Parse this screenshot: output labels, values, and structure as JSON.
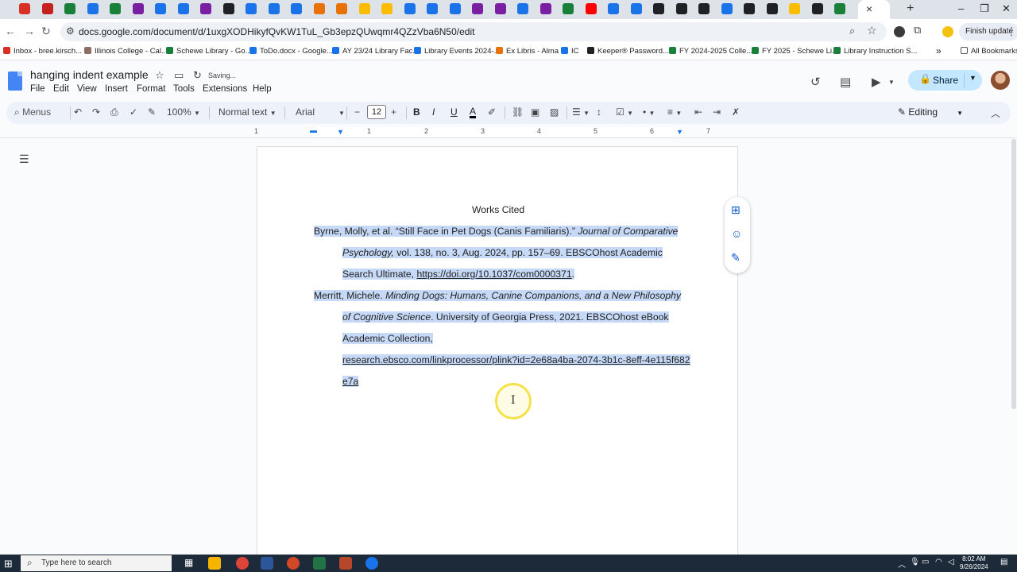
{
  "browser": {
    "url": "docs.google.com/document/d/1uxgXODHikyfQvKW1TuL_Gb3epzQUwqmr4QZzVba6N50/edit",
    "finish_update_label": "Finish update",
    "tab_close_glyph": "×",
    "new_tab_glyph": "+",
    "window_controls": {
      "minimize": "–",
      "restore": "❐",
      "close": "✕"
    },
    "tab_colors": [
      "#d93025",
      "#c5221f",
      "#188038",
      "#1a73e8",
      "#188038",
      "#7b1fa2",
      "#1a73e8",
      "#1a73e8",
      "#7b1fa2",
      "#202124",
      "#1a73e8",
      "#1a73e8",
      "#1a73e8",
      "#e8710a",
      "#e8710a",
      "#fbbc04",
      "#fbbc04",
      "#1a73e8",
      "#1a73e8",
      "#1a73e8",
      "#7b1fa2",
      "#7b1fa2",
      "#1a73e8",
      "#7b1fa2",
      "#188038",
      "#ff0000",
      "#1a73e8",
      "#1a73e8",
      "#202124",
      "#202124",
      "#202124",
      "#1a73e8",
      "#202124",
      "#202124",
      "#fbbc04",
      "#202124",
      "#188038",
      "#1a73e8"
    ]
  },
  "bookmarks": {
    "items": [
      {
        "label": "Inbox - bree.kirsch...",
        "color": "#d93025"
      },
      {
        "label": "Illinois College - Cal...",
        "color": "#8d6e63"
      },
      {
        "label": "Schewe Library - Go...",
        "color": "#188038"
      },
      {
        "label": "ToDo.docx - Google...",
        "color": "#1a73e8"
      },
      {
        "label": "AY 23/24 Library Fac...",
        "color": "#1a73e8"
      },
      {
        "label": "Library Events 2024-...",
        "color": "#1a73e8"
      },
      {
        "label": "Ex Libris - Alma",
        "color": "#e8710a"
      },
      {
        "label": "IC",
        "color": "#1a73e8"
      },
      {
        "label": "Keeper® Password...",
        "color": "#202124"
      },
      {
        "label": "FY 2024-2025 Colle...",
        "color": "#188038"
      },
      {
        "label": "FY 2025 - Schewe Li...",
        "color": "#188038"
      },
      {
        "label": "Library Instruction S...",
        "color": "#188038"
      }
    ],
    "more_glyph": "»",
    "all_bookmarks_label": "All Bookmarks"
  },
  "docs": {
    "title": "hanging indent example",
    "saving_label": "Saving...",
    "menu": [
      "File",
      "Edit",
      "View",
      "Insert",
      "Format",
      "Tools",
      "Extensions",
      "Help"
    ],
    "share_label": "Share",
    "toolbar": {
      "search_menus_label": "Menus",
      "zoom": "100%",
      "style": "Normal text",
      "font": "Arial",
      "font_size": "12",
      "editing_label": "Editing"
    }
  },
  "ruler": {
    "numbers": [
      "1",
      "1",
      "2",
      "3",
      "4",
      "5",
      "6",
      "7"
    ]
  },
  "document": {
    "heading": "Works Cited",
    "entries": [
      {
        "lines": [
          "Byrne, Molly, et al. “Still Face in Pet Dogs (Canis Familiaris).” ",
          "Journal of Comparative",
          "Psychology,",
          " vol. 138, no. 3, Aug. 2024, pp. 157–69. EBSCOhost Academic",
          "Search Ultimate, ",
          "https://doi.org/10.1037/com0000371",
          "."
        ]
      },
      {
        "lines": [
          "Merritt, Michele. ",
          "Minding Dogs: Humans, Canine Companions, and a New Philosophy",
          "of Cognitive Science",
          ". University of Georgia Press, 2021. EBSCOhost eBook",
          "Academic Collection,",
          "research.ebsco.com/linkprocessor/plink?id=2e68a4ba-2074-3b1c-8eff-4e115f682",
          "e7a"
        ]
      }
    ],
    "selection_color": "#c6d9f7"
  },
  "taskbar": {
    "search_placeholder": "Type here to search",
    "time": "8:02 AM",
    "date": "9/26/2024"
  }
}
